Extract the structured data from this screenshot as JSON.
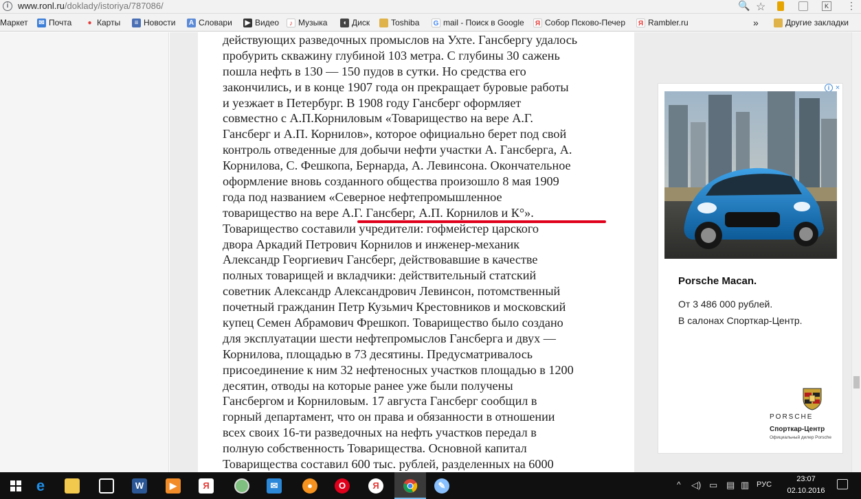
{
  "browser": {
    "url_host": "www.ronl.ru",
    "url_path": "/doklady/istoriya/787086/",
    "icons": [
      "info-icon",
      "zoom-icon",
      "star-icon",
      "menu-icon"
    ]
  },
  "bookmarks": {
    "items": [
      {
        "label": "Маркет",
        "icon": "market-icon",
        "color": "#f2f2f2"
      },
      {
        "label": "Почта",
        "icon": "mail-icon",
        "color": "#3c7ed8"
      },
      {
        "label": "Карты",
        "icon": "map-pin-icon",
        "color": "#e53935"
      },
      {
        "label": "Новости",
        "icon": "news-icon",
        "color": "#4a6fb5"
      },
      {
        "label": "Словари",
        "icon": "dictionary-icon",
        "color": "#5b8ad6"
      },
      {
        "label": "Видео",
        "icon": "video-icon",
        "color": "#333333"
      },
      {
        "label": "Музыка",
        "icon": "music-icon",
        "color": "#d33"
      },
      {
        "label": "Диск",
        "icon": "disk-icon",
        "color": "#444444"
      },
      {
        "label": "Toshiba",
        "icon": "folder-icon",
        "color": "#e0b24a"
      },
      {
        "label": "mail - Поиск в Google",
        "icon": "google-icon",
        "color": "#4285f4"
      },
      {
        "label": "Собор Псково-Печер",
        "icon": "yandex-icon",
        "color": "#e53935"
      },
      {
        "label": "Rambler.ru",
        "icon": "yandex-icon",
        "color": "#e53935"
      }
    ],
    "overflow": "»",
    "other_label": "Другие закладки"
  },
  "article": {
    "lines": [
      "действующих разведочных промыслов на Ухте. Гансбергу удалось",
      "пробурить скважину глубиной 103 метра. С глубины 30 сажень",
      "пошла нефть в 130 — 150 пудов в сутки. Но средства его",
      "закончились, и в конце 1907 года он прекращает буровые работы",
      "и уезжает в Петербург. В 1908 году Гансберг оформляет",
      "совместно с А.П.Корниловым «Товарищество на вере А.Г.",
      "Гансберг и А.П. Корнилов», которое официально берет под свой",
      "контроль отведенные для добычи нефти участки А. Гансберга, А.",
      "Корнилова, С. Фешкопа, Бернарда, А. Левинсона. Окончательное",
      "оформление вновь созданного общества произошло 8 мая 1909",
      "года под названием «Северное нефтепромышленное",
      "товарищество на вере А.Г. Гансберг, А.П. Корнилов и К°».",
      "Товарищество составили учредители: гофмейстер царского",
      "двора Аркадий Петрович Корнилов и инженер-механик",
      "Александр Георгиевич Гансберг, действовавшие в качестве",
      "полных товарищей и вкладчики: действительный статский",
      "советник Александр Александрович Левинсон, потомственный",
      "почетный гражданин Петр Кузьмич Крестовников и московский",
      "купец Семен Абрамович Фрешкоп. Товарищество было создано",
      "для эксплуатации шести нефтепромыслов Гансберга и двух —",
      "Корнилова, площадью в 73 десятины. Предусматривалось",
      "присоединение к ним 32 нефтеносных участков площадью в 1200",
      "десятин, отводы на которые ранее уже были получены",
      "Гансбергом и Корниловым. 17 августа Гансберг сообщил в",
      "горный департамент, что он права и обязанности в отношении",
      "всех своих 16-ти разведочных на нефть участков передал в",
      "полную собственность Товарищества. Основной капитал",
      "Товарищества составил 600 тыс. рублей, разделенных на 6000"
    ],
    "underline_color": "#e0001b"
  },
  "ad": {
    "info_icon": "adchoices-icon",
    "title": "Porsche Macan.",
    "price": "От 3 486 000 рублей.",
    "place": "В салонах Спорткар-Центр.",
    "brand": "PORSCHE",
    "dealer": "Спорткар-Центр",
    "dealer_sub": "Официальный дилер Porsche",
    "car_color": "#1f7fc4"
  },
  "taskbar": {
    "apps": [
      {
        "name": "windows-start-icon",
        "color": "#ffffff"
      },
      {
        "name": "edge-icon",
        "color": "#1e8fe8"
      },
      {
        "name": "explorer-icon",
        "color": "#f2c94c"
      },
      {
        "name": "store-icon",
        "color": "#ffffff"
      },
      {
        "name": "word-icon",
        "color": "#2b5797"
      },
      {
        "name": "media-player-icon",
        "color": "#f28c28"
      },
      {
        "name": "yandex-browser-icon",
        "color": "#e53935"
      },
      {
        "name": "app-circle-icon",
        "color": "#7fbf7f"
      },
      {
        "name": "mail-icon",
        "color": "#2b88d8"
      },
      {
        "name": "odnoklassniki-icon",
        "color": "#f7931e"
      },
      {
        "name": "opera-icon",
        "color": "#e0001b"
      },
      {
        "name": "yandex-icon",
        "color": "#e53935"
      },
      {
        "name": "chrome-icon",
        "color": "#34a853"
      },
      {
        "name": "paint-icon",
        "color": "#88c0ff"
      }
    ],
    "lang": "РУС",
    "time": "23:07",
    "date": "02.10.2016"
  }
}
